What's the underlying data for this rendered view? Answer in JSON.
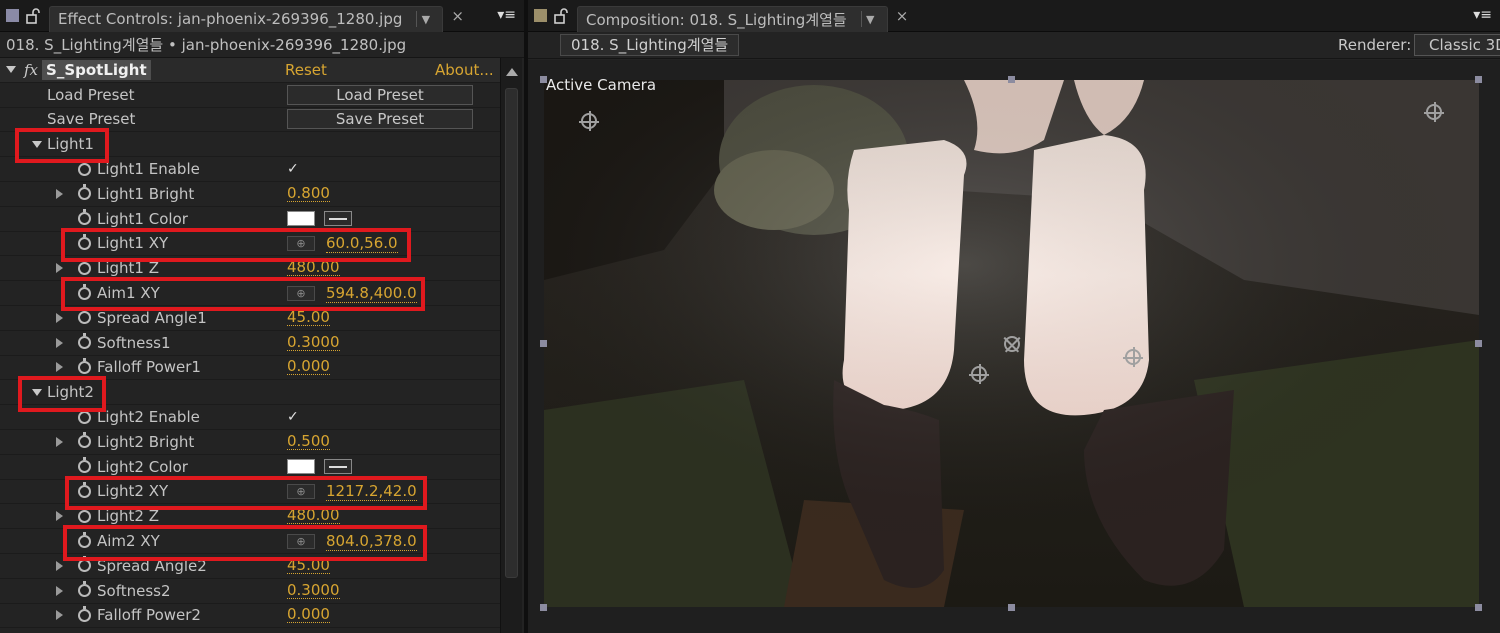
{
  "effect_controls": {
    "tab_title": "Effect Controls: jan-phoenix-269396_1280.jpg",
    "close_label": "×",
    "menu_label": "▾≡",
    "subheader": "018. S_Lighting계열들 • jan-phoenix-269396_1280.jpg",
    "effect": {
      "fx_badge": "fx",
      "name": "S_SpotLight",
      "reset_label": "Reset",
      "about_label": "About..."
    },
    "load_preset": {
      "label": "Load Preset",
      "button": "Load Preset"
    },
    "save_preset": {
      "label": "Save Preset",
      "button": "Save Preset"
    },
    "light1": {
      "group_label": "Light1",
      "enable_label": "Light1 Enable",
      "enable_checked": true,
      "bright_label": "Light1 Bright",
      "bright_value": "0.800",
      "color_label": "Light1 Color",
      "color_value": "#ffffff",
      "xy_label": "Light1 XY",
      "xy_value": "60.0,56.0",
      "z_label": "Light1 Z",
      "z_value": "480.00",
      "aim_label": "Aim1 XY",
      "aim_value": "594.8,400.0",
      "spread_label": "Spread Angle1",
      "spread_value": "45.00",
      "softness_label": "Softness1",
      "softness_value": "0.3000",
      "falloff_label": "Falloff Power1",
      "falloff_value": "0.000"
    },
    "light2": {
      "group_label": "Light2",
      "enable_label": "Light2 Enable",
      "enable_checked": true,
      "bright_label": "Light2 Bright",
      "bright_value": "0.500",
      "color_label": "Light2 Color",
      "color_value": "#ffffff",
      "xy_label": "Light2 XY",
      "xy_value": "1217.2,42.0",
      "z_label": "Light2 Z",
      "z_value": "480.00",
      "aim_label": "Aim2 XY",
      "aim_value": "804.0,378.0",
      "spread_label": "Spread Angle2",
      "spread_value": "45.00",
      "softness_label": "Softness2",
      "softness_value": "0.3000",
      "falloff_label": "Falloff Power2",
      "falloff_value": "0.000"
    },
    "checkmark": "✓"
  },
  "composition": {
    "tab_title": "Composition: 018. S_Lighting계열들",
    "close_label": "×",
    "menu_label": "▾≡",
    "comp_name": "018. S_Lighting계열들",
    "renderer_label": "Renderer:",
    "renderer_value": "Classic 3D",
    "viewer_label": "Active Camera"
  },
  "colors": {
    "accent_value": "#d7a531",
    "highlight_box": "#e0191e"
  }
}
